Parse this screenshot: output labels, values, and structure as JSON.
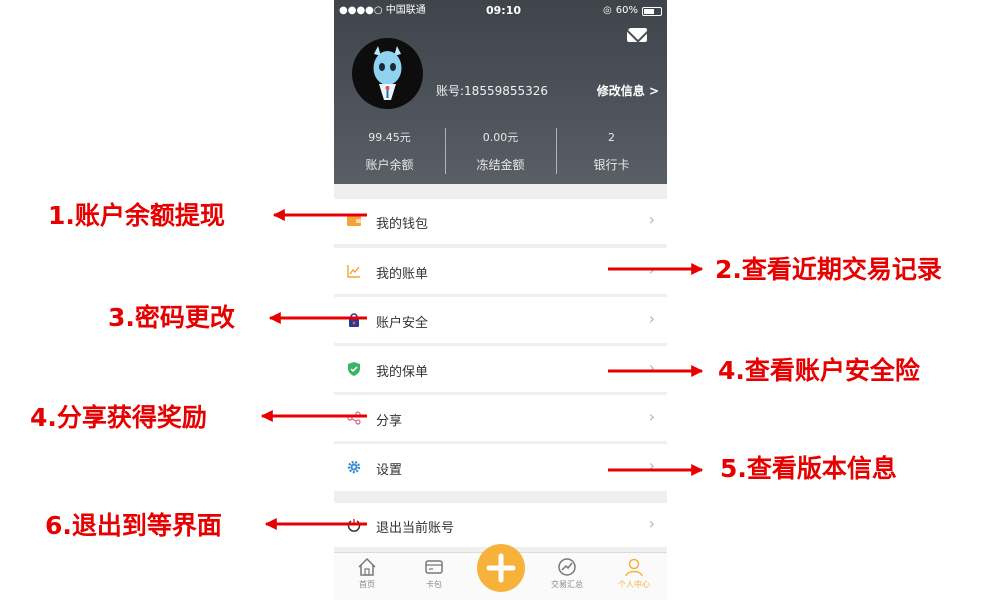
{
  "status_bar": {
    "carrier": "●●●●○ 中国联通",
    "time": "09:10",
    "battery": "60%",
    "battery_level": 0.6
  },
  "profile": {
    "account": "账号:18559855326",
    "edit": "修改信息 >"
  },
  "stats": [
    {
      "value": "99.45元",
      "label": "账户余额"
    },
    {
      "value": "0.00元",
      "label": "冻结金额"
    },
    {
      "value": "2",
      "label": "银行卡"
    }
  ],
  "menu": [
    {
      "label": "我的钱包",
      "icon": "wallet-icon"
    },
    {
      "label": "我的账单",
      "icon": "chart-line-icon"
    },
    {
      "label": "账户安全",
      "icon": "lock-icon"
    },
    {
      "label": "我的保单",
      "icon": "shield-check-icon"
    },
    {
      "label": "分享",
      "icon": "share-icon"
    },
    {
      "label": "设置",
      "icon": "gear-icon"
    }
  ],
  "logout": {
    "label": "退出当前账号",
    "icon": "power-icon"
  },
  "tabs": [
    {
      "label": "首页",
      "icon": "home-icon"
    },
    {
      "label": "卡包",
      "icon": "card-icon"
    },
    {
      "label": "交易汇总",
      "icon": "trend-icon"
    },
    {
      "label": "个人中心",
      "icon": "person-icon",
      "active": true
    }
  ],
  "colors": {
    "header": "#4a4f56",
    "accent": "#f6b23a",
    "annotation": "#e60000"
  },
  "annotations": [
    {
      "text": "1.账户余额提现",
      "side": "left"
    },
    {
      "text": "2.查看近期交易记录",
      "side": "right"
    },
    {
      "text": "3.密码更改",
      "side": "left"
    },
    {
      "text": "4.查看账户安全险",
      "side": "right"
    },
    {
      "text": "4.分享获得奖励",
      "side": "left"
    },
    {
      "text": "5.查看版本信息",
      "side": "right"
    },
    {
      "text": "6.退出到等界面",
      "side": "left"
    }
  ]
}
